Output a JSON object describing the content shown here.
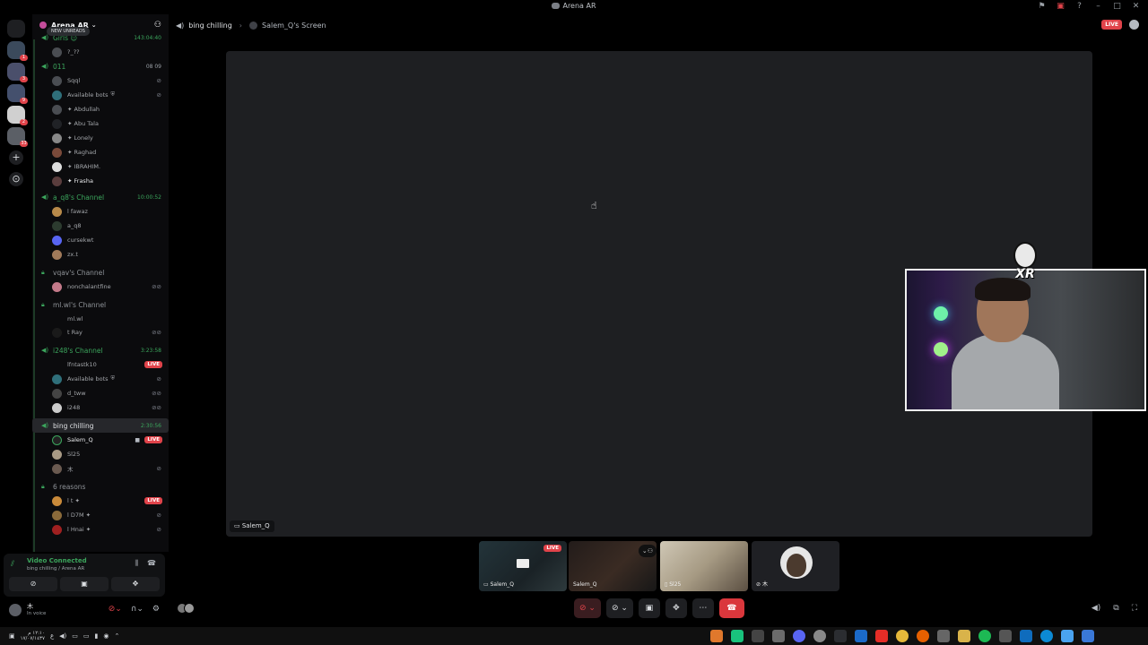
{
  "window": {
    "title": "Arena AR"
  },
  "server": {
    "name": "Arena AR",
    "new_unreads": "NEW UNREADS"
  },
  "sidebar": {
    "channels": [
      {
        "name": "Girls ☺",
        "time": "143:04:40",
        "users": [
          {
            "name": "?_??"
          }
        ]
      },
      {
        "name": "011",
        "count": "08 09",
        "users": [
          {
            "name": "Sqql"
          },
          {
            "name": "Available bots"
          },
          {
            "name": "✦ Abdullah"
          },
          {
            "name": "✦ Abu Tala"
          },
          {
            "name": "✦ Lonely"
          },
          {
            "name": "✦ Raghad"
          },
          {
            "name": "✦ IBRAHIM."
          },
          {
            "name": "✦ Frasha"
          }
        ]
      },
      {
        "name": "a_q8's Channel",
        "time": "10:00:52",
        "users": [
          {
            "name": "l fawaz"
          },
          {
            "name": "a_q8"
          },
          {
            "name": "cursekwt"
          },
          {
            "name": "zx.t"
          }
        ]
      },
      {
        "name": "vqav's Channel",
        "locked": true,
        "users": [
          {
            "name": "nonchalantfine"
          }
        ]
      },
      {
        "name": "ml.wl's Channel",
        "locked": true,
        "users": [
          {
            "name": "ml.wl"
          },
          {
            "name": "t Ray"
          }
        ]
      },
      {
        "name": "i248's Channel",
        "time": "3:23:58",
        "users": [
          {
            "name": "lfntastk10",
            "live": "LIVE"
          },
          {
            "name": "Available bots"
          },
          {
            "name": "d_tww"
          },
          {
            "name": "i248"
          }
        ]
      },
      {
        "name": "bing chilling",
        "time": "2:30:56",
        "users": [
          {
            "name": "Salem_Q",
            "live": "LIVE"
          },
          {
            "name": "Sl25"
          },
          {
            "name": "木"
          }
        ]
      },
      {
        "name": "6 reasons",
        "locked": true,
        "users": [
          {
            "name": "l t ✦",
            "live": "LIVE"
          },
          {
            "name": "l D7M ✦"
          },
          {
            "name": "l Hnai ✦"
          }
        ]
      }
    ]
  },
  "voice_panel": {
    "status": "Video Connected",
    "location": "bing chilling / Arena AR"
  },
  "user": {
    "name": "木",
    "status": "In voice"
  },
  "header": {
    "channel": "bing chilling",
    "screen": "Salem_Q's Screen",
    "live": "LIVE"
  },
  "stage": {
    "label": "Salem_Q"
  },
  "thumbnails": [
    {
      "label": "Salem_Q",
      "live": "LIVE"
    },
    {
      "label": "Salem_Q"
    },
    {
      "label": "Sl25"
    },
    {
      "label": "木"
    }
  ],
  "overlay": {
    "logo_text": "XR"
  },
  "taskbar": {
    "time": "١٢:١٠ م",
    "date": "١٧/٠٧/١٤٣٧"
  },
  "colors": {
    "accent_green": "#3ba55c",
    "live_red": "#e0434a",
    "stage_bg": "#1e1f22"
  }
}
